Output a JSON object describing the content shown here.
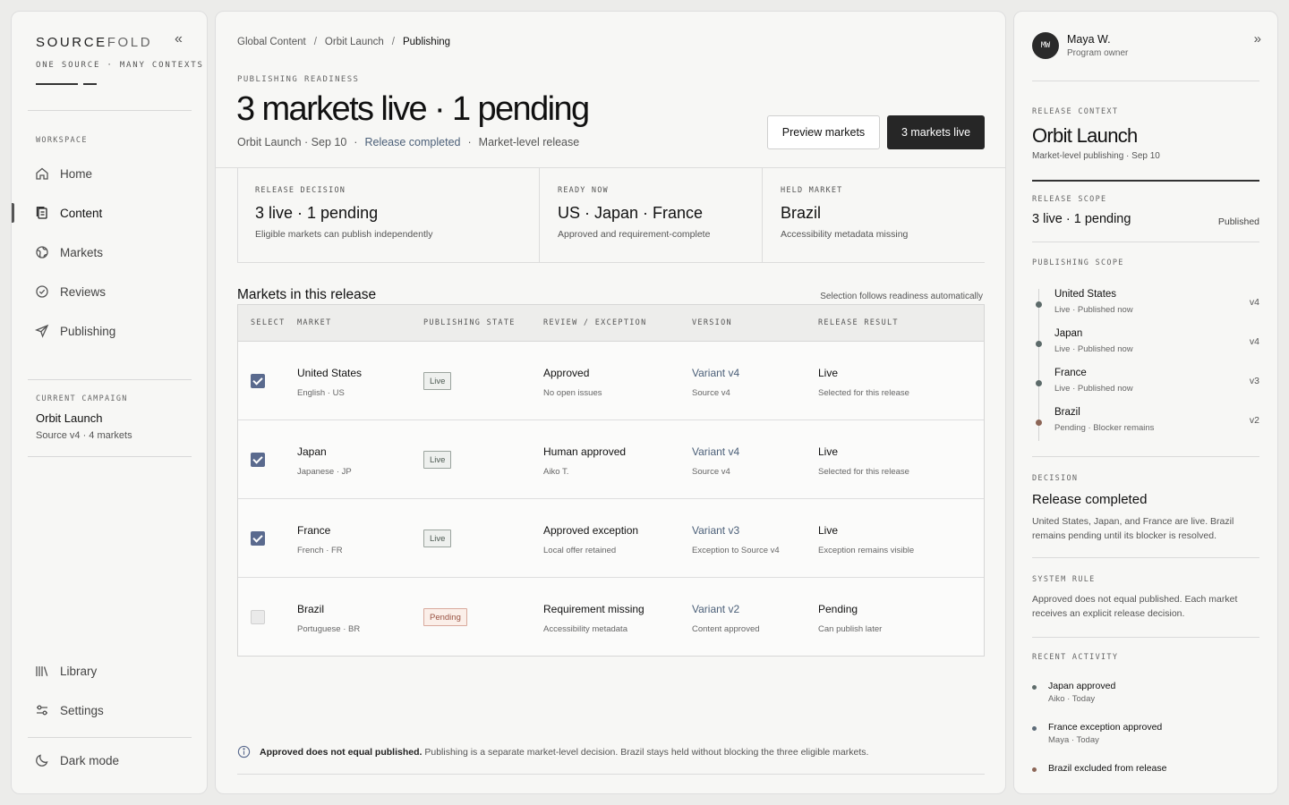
{
  "sidebar": {
    "brand_left": "SOURCE",
    "brand_right": "FOLD",
    "tagline": "ONE SOURCE · MANY CONTEXTS",
    "workspace_label": "WORKSPACE",
    "nav": [
      {
        "label": "Home",
        "icon": "home-icon"
      },
      {
        "label": "Content",
        "icon": "document-icon",
        "active": true
      },
      {
        "label": "Markets",
        "icon": "globe-icon"
      },
      {
        "label": "Reviews",
        "icon": "check-circle-icon"
      },
      {
        "label": "Publishing",
        "icon": "send-icon"
      }
    ],
    "campaign_label": "CURRENT CAMPAIGN",
    "campaign_name": "Orbit Launch",
    "campaign_sub": "Source v4 · 4 markets",
    "library": "Library",
    "settings": "Settings",
    "dark_mode": "Dark mode"
  },
  "breadcrumb": [
    "Global Content",
    "Orbit Launch",
    "Publishing"
  ],
  "header": {
    "eyebrow": "PUBLISHING READINESS",
    "title": "3 markets live · 1 pending",
    "sub_campaign": "Orbit Launch · Sep 10",
    "sub_status": "Release completed",
    "sub_scope": "Market-level release",
    "btn_preview": "Preview markets",
    "btn_live": "3 markets live"
  },
  "stats": [
    {
      "label": "RELEASE DECISION",
      "value": "3 live · 1 pending",
      "desc": "Eligible markets can publish independently"
    },
    {
      "label": "READY NOW",
      "value": "US · Japan · France",
      "desc": "Approved and requirement-complete"
    },
    {
      "label": "HELD MARKET",
      "value": "Brazil",
      "desc": "Accessibility metadata missing"
    }
  ],
  "table": {
    "title": "Markets in this release",
    "note": "Selection follows readiness automatically",
    "headers": [
      "SELECT",
      "MARKET",
      "PUBLISHING STATE",
      "REVIEW / EXCEPTION",
      "VERSION",
      "RELEASE RESULT"
    ],
    "rows": [
      {
        "checked": true,
        "market": "United States",
        "locale": "English · US",
        "state": "Live",
        "review": "Approved",
        "review_sub": "No open issues",
        "version": "Variant v4",
        "version_sub": "Source v4",
        "result": "Live",
        "result_sub": "Selected for this release"
      },
      {
        "checked": true,
        "market": "Japan",
        "locale": "Japanese · JP",
        "state": "Live",
        "review": "Human approved",
        "review_sub": "Aiko T.",
        "version": "Variant v4",
        "version_sub": "Source v4",
        "result": "Live",
        "result_sub": "Selected for this release"
      },
      {
        "checked": true,
        "market": "France",
        "locale": "French · FR",
        "state": "Live",
        "review": "Approved exception",
        "review_sub": "Local offer retained",
        "version": "Variant v3",
        "version_sub": "Exception to Source v4",
        "result": "Live",
        "result_sub": "Exception remains visible"
      },
      {
        "checked": false,
        "market": "Brazil",
        "locale": "Portuguese · BR",
        "state": "Pending",
        "review": "Requirement missing",
        "review_sub": "Accessibility metadata",
        "version": "Variant v2",
        "version_sub": "Content approved",
        "result": "Pending",
        "result_sub": "Can publish later"
      }
    ]
  },
  "footer": {
    "bold": "Approved does not equal published.",
    "text": "Publishing is a separate market-level decision. Brazil stays held without blocking the three eligible markets."
  },
  "right": {
    "avatar": "MW",
    "user_name": "Maya W.",
    "user_role": "Program owner",
    "context_label": "RELEASE CONTEXT",
    "context_title": "Orbit Launch",
    "context_sub": "Market-level publishing · Sep 10",
    "scope_label": "RELEASE SCOPE",
    "scope_value": "3 live · 1 pending",
    "scope_badge": "Published",
    "pub_label": "PUBLISHING SCOPE",
    "timeline": [
      {
        "name": "United States",
        "sub": "Live · Published now",
        "ver": "v4",
        "color": "#5d6b6a"
      },
      {
        "name": "Japan",
        "sub": "Live · Published now",
        "ver": "v4",
        "color": "#5d6b6a"
      },
      {
        "name": "France",
        "sub": "Live · Published now",
        "ver": "v3",
        "color": "#5d6b6a"
      },
      {
        "name": "Brazil",
        "sub": "Pending · Blocker remains",
        "ver": "v2",
        "color": "#8c6657"
      }
    ],
    "decision_label": "DECISION",
    "decision_title": "Release completed",
    "decision_body": "United States, Japan, and France are live. Brazil remains pending until its blocker is resolved.",
    "rule_label": "SYSTEM RULE",
    "rule_body": "Approved does not equal published. Each market receives an explicit release decision.",
    "activity_label": "RECENT ACTIVITY",
    "activity": [
      {
        "title": "Japan approved",
        "sub": "Aiko · Today",
        "color": "#5d6b6a"
      },
      {
        "title": "France exception approved",
        "sub": "Maya · Today",
        "color": "#5d6b78"
      },
      {
        "title": "Brazil excluded from release",
        "sub": "",
        "color": "#8c6657"
      }
    ]
  }
}
